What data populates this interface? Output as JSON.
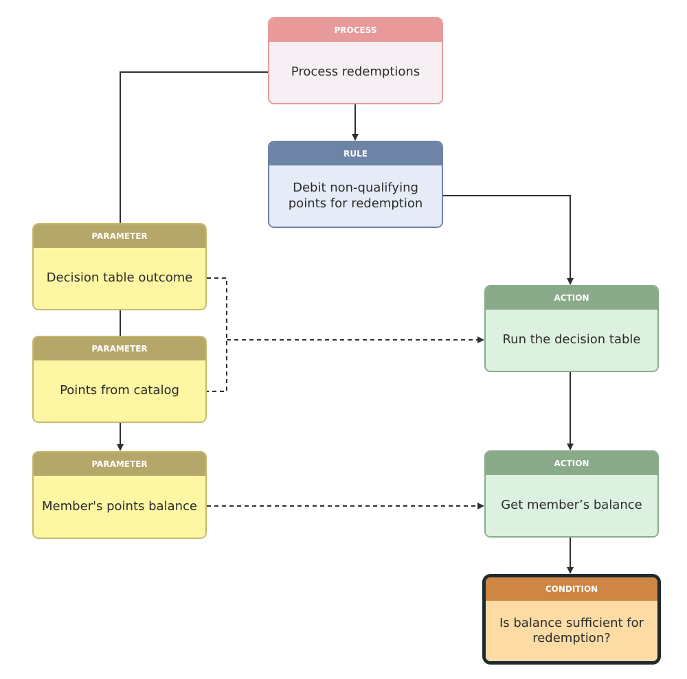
{
  "colors": {
    "line": "#2b3036"
  },
  "nodes": {
    "process": {
      "type": "PROCESS",
      "text": "Process redemptions",
      "header_color": "#e89a9a",
      "body_color": "#f6eff3",
      "border_color": "#e89a9a"
    },
    "rule": {
      "type": "RULE",
      "text": "Debit non-qualifying points for redemption",
      "header_color": "#6d84a6",
      "body_color": "#e5ecf7",
      "border_color": "#6d84a6"
    },
    "param1": {
      "type": "PARAMETER",
      "text": "Decision table outcome",
      "header_color": "#b5a66a",
      "body_color": "#fdf6a3",
      "border_color": "#c9b86a"
    },
    "param2": {
      "type": "PARAMETER",
      "text": "Points from catalog",
      "header_color": "#b5a66a",
      "body_color": "#fdf6a3",
      "border_color": "#c9b86a"
    },
    "param3": {
      "type": "PARAMETER",
      "text": "Member's points balance",
      "header_color": "#b5a66a",
      "body_color": "#fdf6a3",
      "border_color": "#c9b86a"
    },
    "action1": {
      "type": "ACTION",
      "text": "Run the decision table",
      "header_color": "#8aab8a",
      "body_color": "#dcf1df",
      "border_color": "#8aab8a"
    },
    "action2": {
      "type": "ACTION",
      "text": "Get member’s balance",
      "header_color": "#8aab8a",
      "body_color": "#dcf1df",
      "border_color": "#8aab8a"
    },
    "condition": {
      "type": "CONDITION",
      "text": "Is balance sufficient for redemption?",
      "header_color": "#cd8643",
      "body_color": "#fcdba4",
      "border_color": "#1f2a30"
    }
  }
}
